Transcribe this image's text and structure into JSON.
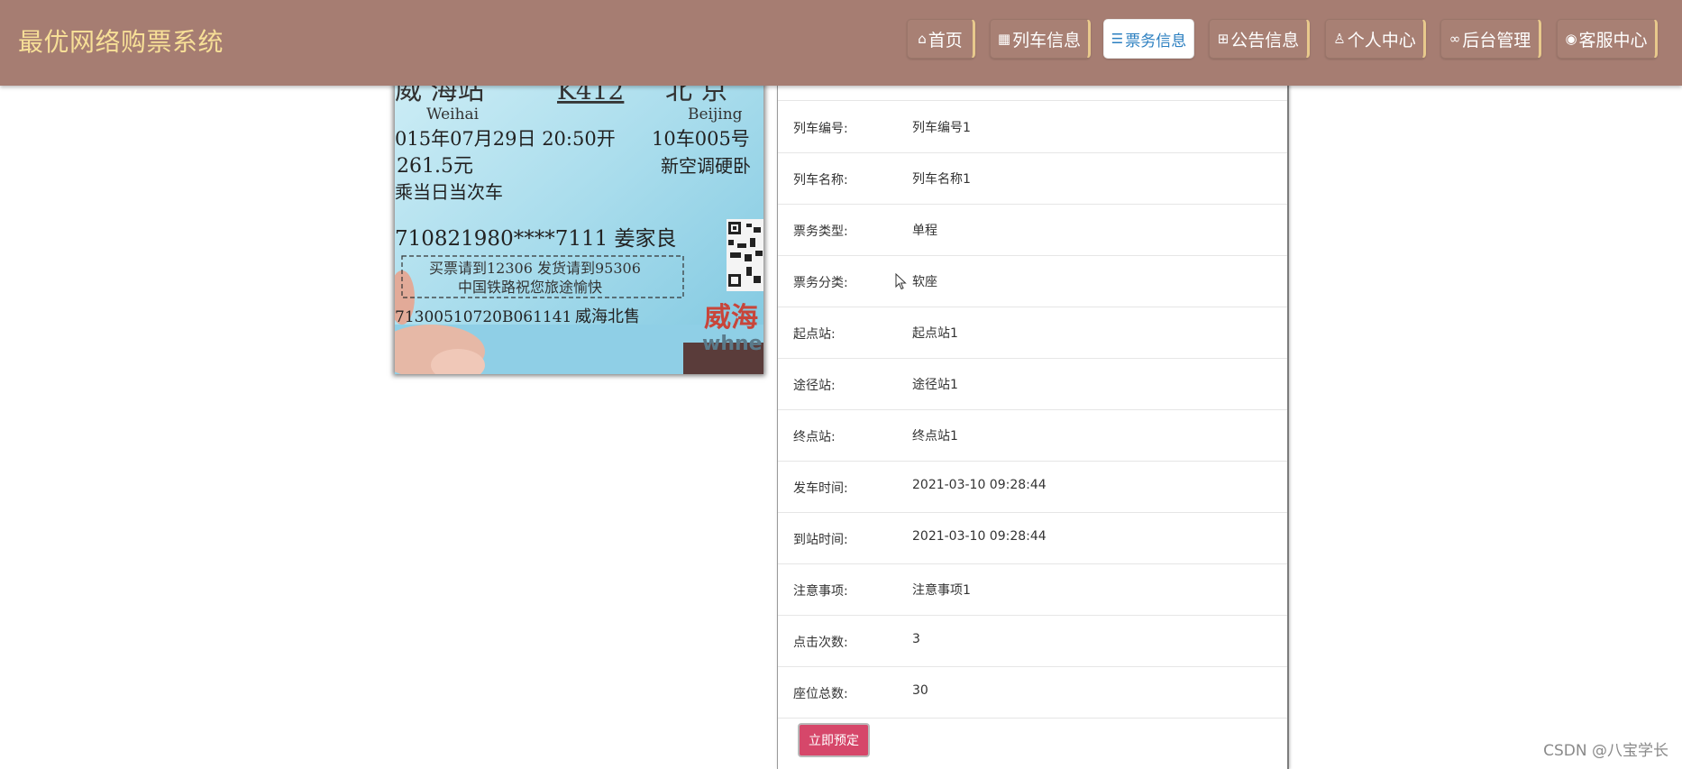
{
  "brand": {
    "title": "最优网络购票系统"
  },
  "nav": {
    "items": [
      {
        "label": "首页",
        "icon": "home-icon"
      },
      {
        "label": "列车信息",
        "icon": "train-icon"
      },
      {
        "label": "票务信息",
        "icon": "sliders-icon",
        "active": true
      },
      {
        "label": "公告信息",
        "icon": "gift-icon"
      },
      {
        "label": "个人中心",
        "icon": "user-icon"
      },
      {
        "label": "后台管理",
        "icon": "link-icon"
      },
      {
        "label": "客服中心",
        "icon": "headset-icon"
      }
    ]
  },
  "ticket_image": {
    "lines": {
      "from_station": "威 海站",
      "train_no": "K412",
      "to_station": "北 京",
      "from_pinyin": "Weihai",
      "to_pinyin": "Beijing",
      "date": "015年07月29日 20:50开",
      "seat": "10车005号",
      "price": "261.5元",
      "seat_type": "新空调硬卧",
      "note": "乘当日当次车",
      "id_name": "710821980****7111 姜家良",
      "tip_line1": "买票请到12306 发货请到95306",
      "tip_line2": "中国铁路祝您旅途愉快",
      "serial": "71300510720B061141",
      "sale_place": "威海北售",
      "logo": "威海",
      "logo_sub": "whne"
    }
  },
  "details": [
    {
      "label": "列车编号:",
      "value": "列车编号1"
    },
    {
      "label": "列车名称:",
      "value": "列车名称1"
    },
    {
      "label": "票务类型:",
      "value": "单程"
    },
    {
      "label": "票务分类:",
      "value": "软座"
    },
    {
      "label": "起点站:",
      "value": "起点站1"
    },
    {
      "label": "途径站:",
      "value": "途径站1"
    },
    {
      "label": "终点站:",
      "value": "终点站1"
    },
    {
      "label": "发车时间:",
      "value": "2021-03-10 09:28:44"
    },
    {
      "label": "到站时间:",
      "value": "2021-03-10 09:28:44"
    },
    {
      "label": "注意事项:",
      "value": "注意事项1"
    },
    {
      "label": "点击次数:",
      "value": "3"
    },
    {
      "label": "座位总数:",
      "value": "30"
    }
  ],
  "actions": {
    "book_label": "立即预定"
  },
  "watermark": {
    "text": "CSDN @八宝学长"
  },
  "colors": {
    "navbar": "#a67d72",
    "brand": "#f7df97",
    "active_tab_text": "#2b7fc0",
    "book_button": "#d6476a"
  }
}
